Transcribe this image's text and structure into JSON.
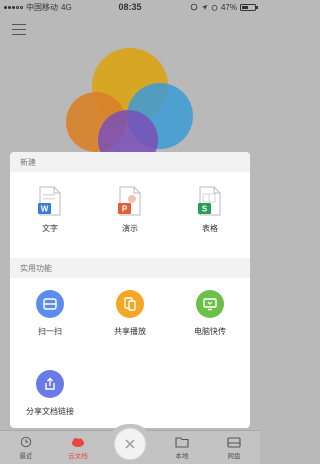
{
  "status": {
    "carrier": "中国移动",
    "network": "4G",
    "time": "08:35",
    "battery": "47%"
  },
  "sections": {
    "new_title": "新建",
    "tools_title": "实用功能"
  },
  "new_items": [
    {
      "label": "文字",
      "icon_letter": "W",
      "color": "#3a7bd5"
    },
    {
      "label": "演示",
      "icon_letter": "P",
      "color": "#e0603a"
    },
    {
      "label": "表格",
      "icon_letter": "S",
      "color": "#2a9d5a"
    }
  ],
  "tools": [
    {
      "label": "扫一扫",
      "color": "#5b8df0"
    },
    {
      "label": "共享播放",
      "color": "#f5a623"
    },
    {
      "label": "电脑快传",
      "color": "#6cc04a"
    },
    {
      "label": "分享文档链接",
      "color": "#6a7be8"
    }
  ],
  "nav": {
    "recent": "最近",
    "cloud": "云文档",
    "local": "本地",
    "drive": "网盘"
  },
  "colors": {
    "accent": "#e8473d"
  }
}
